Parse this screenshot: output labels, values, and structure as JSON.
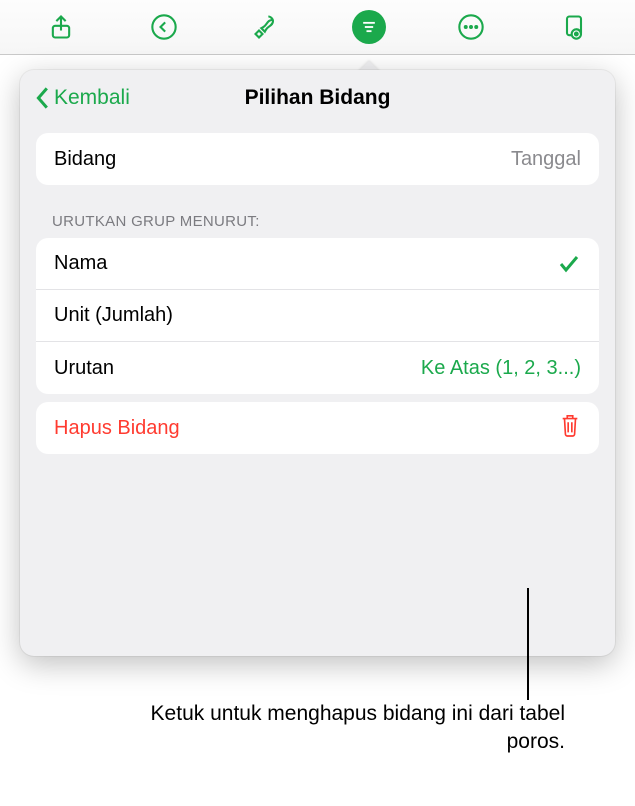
{
  "toolbar": {
    "icons": [
      "share-icon",
      "undo-icon",
      "format-brush-icon",
      "filter-icon",
      "more-icon",
      "preview-icon"
    ]
  },
  "popover": {
    "back_label": "Kembali",
    "title": "Pilihan Bidang",
    "field": {
      "label": "Bidang",
      "value": "Tanggal"
    },
    "sort_section_header": "URUTKAN GRUP MENURUT:",
    "sort_options": [
      {
        "label": "Nama",
        "selected": true
      },
      {
        "label": "Unit (Jumlah)",
        "selected": false
      }
    ],
    "order": {
      "label": "Urutan",
      "value": "Ke Atas (1, 2, 3...)"
    },
    "delete": {
      "label": "Hapus Bidang"
    }
  },
  "callout": {
    "text": "Ketuk untuk menghapus bidang ini dari tabel poros."
  }
}
